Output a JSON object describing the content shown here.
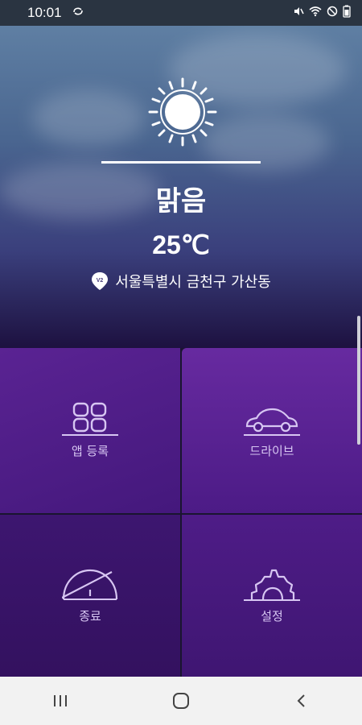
{
  "status_bar": {
    "time": "10:01",
    "left_icon": "sync-icon",
    "right_icons": [
      "mute-icon",
      "wifi-icon",
      "do-not-disturb-icon",
      "battery-icon"
    ]
  },
  "weather": {
    "icon": "sun-icon",
    "condition": "맑음",
    "temperature": "25℃",
    "location": "서울특별시 금천구 가산동"
  },
  "tiles": [
    {
      "label": "앱 등록",
      "icon": "app-grid-icon"
    },
    {
      "label": "드라이브",
      "icon": "car-icon"
    },
    {
      "label": "종료",
      "icon": "gauge-off-icon"
    },
    {
      "label": "설정",
      "icon": "gear-icon"
    }
  ],
  "nav": {
    "buttons": [
      "recent-apps-icon",
      "home-icon",
      "back-icon"
    ]
  },
  "colors": {
    "tile_text": "#d7c6f2",
    "accent_purple": "#4c1b86"
  }
}
